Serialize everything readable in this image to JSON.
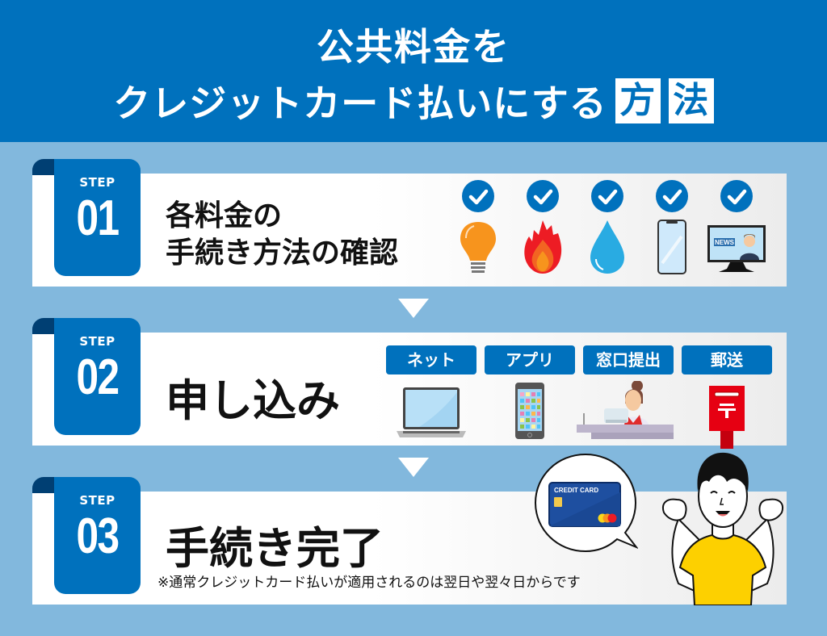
{
  "header": {
    "line1": "公共料金を",
    "line2_main": "クレジットカード払いにする",
    "line2_highlight": [
      "方",
      "法"
    ]
  },
  "colors": {
    "primary_blue": "#0071bd",
    "dark_blue": "#003f73",
    "background": "#82b8dd",
    "panel": "#ffffff"
  },
  "steps": [
    {
      "label": "STEP",
      "number": "01",
      "title_line1": "各料金の",
      "title_line2": "手続き方法の確認",
      "utilities": [
        {
          "name": "electricity",
          "icon": "lightbulb-icon",
          "checked": true
        },
        {
          "name": "gas",
          "icon": "flame-icon",
          "checked": true
        },
        {
          "name": "water",
          "icon": "water-drop-icon",
          "checked": true
        },
        {
          "name": "phone",
          "icon": "smartphone-icon",
          "checked": true
        },
        {
          "name": "tv",
          "icon": "tv-news-icon",
          "checked": true,
          "screen_text": "NEWS"
        }
      ]
    },
    {
      "label": "STEP",
      "number": "02",
      "title": "申し込み",
      "methods": [
        {
          "label": "ネット",
          "icon": "laptop-icon"
        },
        {
          "label": "アプリ",
          "icon": "smartphone-app-icon"
        },
        {
          "label": "窓口提出",
          "icon": "counter-clerk-icon"
        },
        {
          "label": "郵送",
          "icon": "mailbox-icon"
        }
      ]
    },
    {
      "label": "STEP",
      "number": "03",
      "title": "手続き完了",
      "note": "※通常クレジットカード払いが適用されるのは翌日や翌々日からです",
      "card_text": "CREDIT CARD"
    }
  ]
}
